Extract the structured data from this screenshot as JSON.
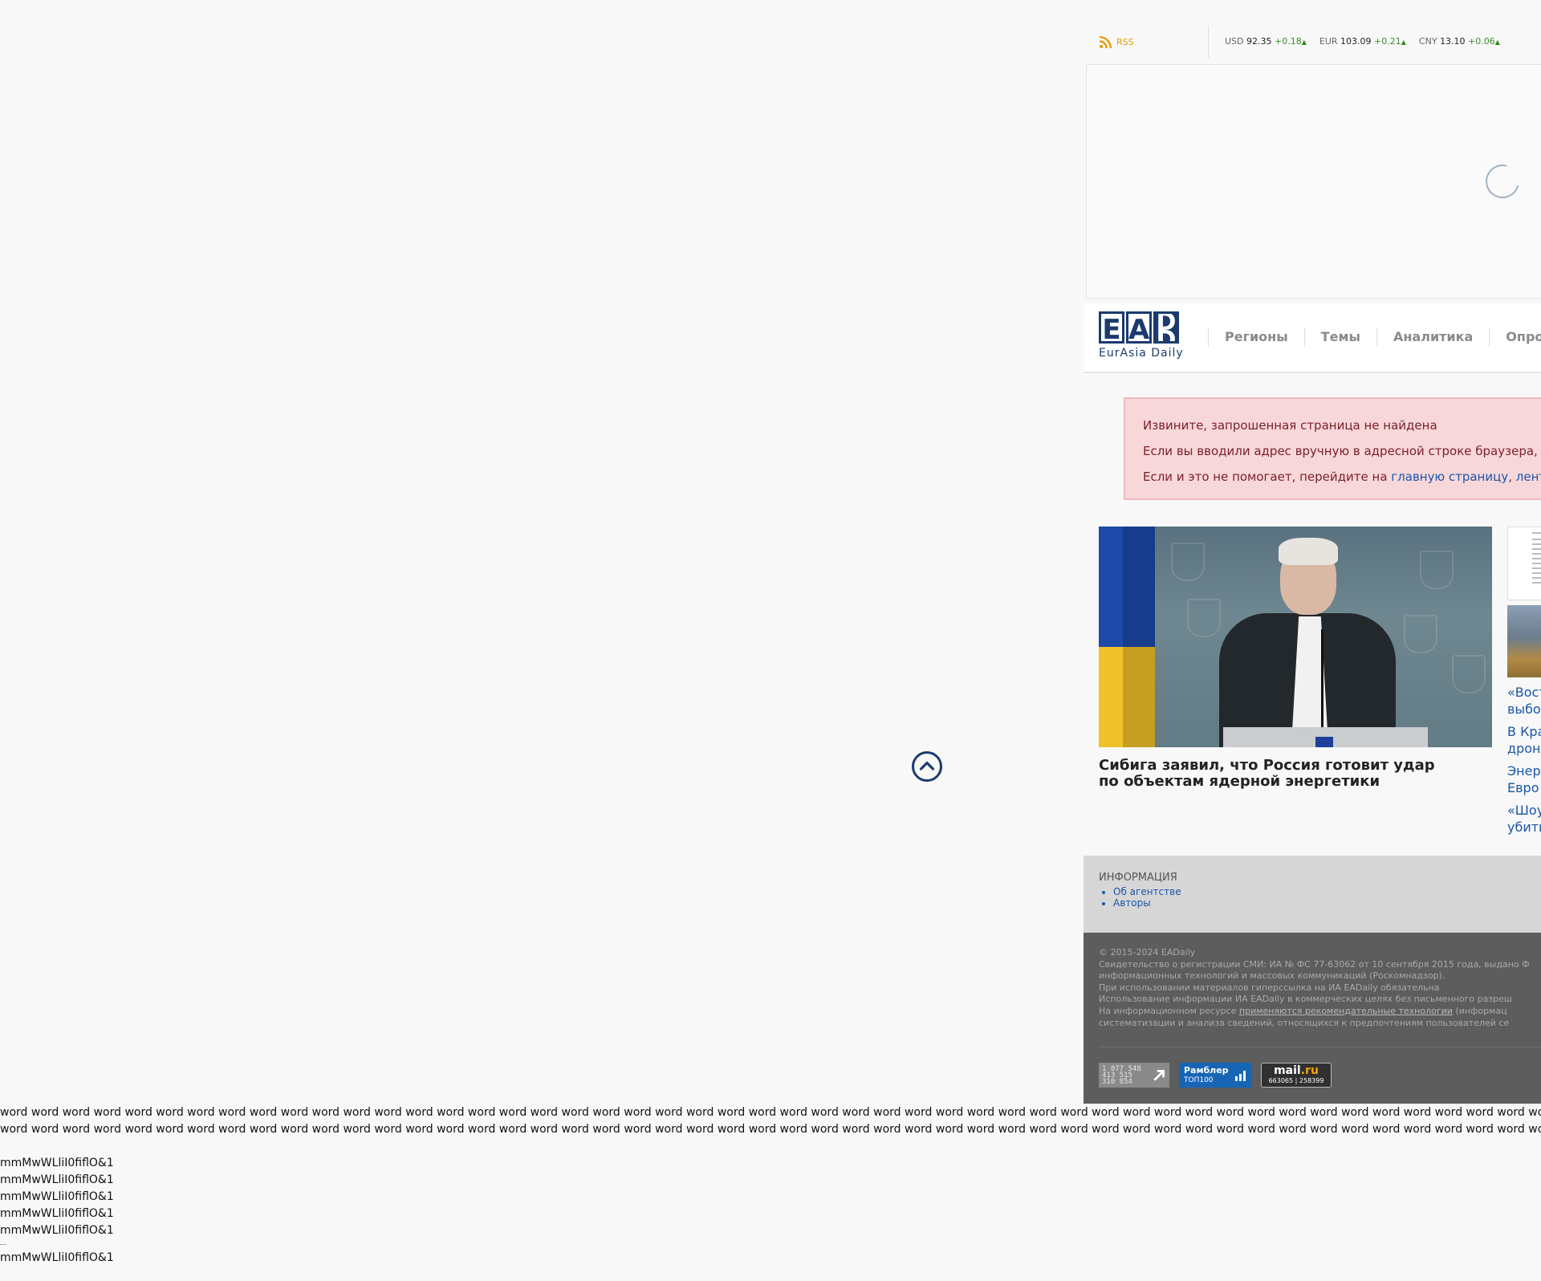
{
  "topbar": {
    "rss_label": "RSS",
    "rates": [
      {
        "currency": "USD",
        "value": "92.35",
        "change": "+0.18"
      },
      {
        "currency": "EUR",
        "value": "103.09",
        "change": "+0.21"
      },
      {
        "currency": "CNY",
        "value": "13.10",
        "change": "+0.06"
      }
    ]
  },
  "header": {
    "logo_subtitle": "EurAsia Daily",
    "nav": [
      "Регионы",
      "Темы",
      "Аналитика",
      "Опросы"
    ]
  },
  "alert": {
    "line1": "Извините, запрошенная страница не найдена",
    "line2": "Если вы вводили адрес вручную в адресной строке браузера, пр",
    "line3_prefix": "Если и это не помогает, перейдите на ",
    "link_home": "главную страницу",
    "separator": ", ",
    "link_feed": "ленту"
  },
  "news": {
    "main_title": "Сибига заявил, что Россия готовит удар по объектам ядерной энергетики",
    "side_links": [
      "«Вост",
      "выбор",
      "В Кра",
      "дрон",
      "Энер",
      "Евро",
      "«Шоу",
      "убить"
    ]
  },
  "info": {
    "title": "ИНФОРМАЦИЯ",
    "links": [
      "Об агентстве",
      "Авторы"
    ]
  },
  "footer": {
    "lines": [
      "© 2015-2024 EADaily",
      "Свидетельство о регистрации СМИ: ИА № ФС 77-63062 от 10 сентября 2015 года, выдано Ф",
      "информационных технологий и массовых коммуникаций (Роскомнадзор).",
      "При использовании материалов гиперссылка на ИА EADaily обязательна",
      "Использование информации ИА EADaily в коммерческих целях без письменного разреш"
    ],
    "tech_prefix": "На информационном ресурсе ",
    "tech_link": "применяются рекомендательные технологии",
    "tech_suffix": " (информац",
    "last_line": "систематизации и анализа сведений, относящихся к предпочтениям пользователей се",
    "counter_li_lines": [
      "1 077 548",
      "413 515",
      "310 854"
    ],
    "counter_rambler_name": "Рамблер",
    "counter_rambler_sub": "ТОП100",
    "counter_mail_name": "mail",
    "counter_mail_domain": ".ru",
    "counter_mail_stats": "663065 | 258399"
  },
  "debug": {
    "word_line": "word word word word word word word word word word word word word word word word word word word word word word word word word word word word word word word word word word word word word word word word word word word word word word word word word word word word word word word word word word word word word word word word word word word word word word word word word word word word word word word word",
    "font_test": "mmMwWLliI0fiflO&1"
  },
  "colors": {
    "brand": "#1b3a6e",
    "link": "#1a56a8",
    "rss": "#e49a00",
    "rate_up": "#3d8a2e",
    "alert_bg": "#f8d7da",
    "footer_bg": "#5d5d5d"
  }
}
